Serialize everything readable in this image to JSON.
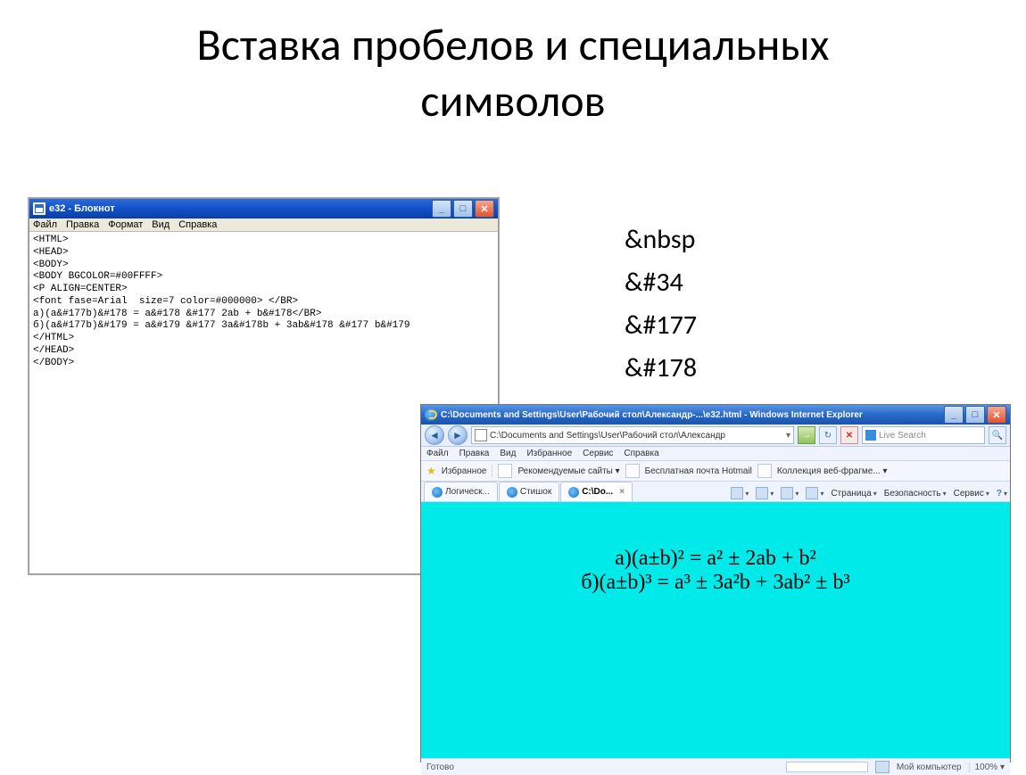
{
  "slide": {
    "title_line1": "Вставка пробелов и специальных",
    "title_line2": "символов"
  },
  "entities": {
    "e1": "&nbsp",
    "e2": "&#34",
    "e3": "&#177",
    "e4": "&#178"
  },
  "notepad": {
    "title": "е32 - Блокнот",
    "menus": {
      "file": "Файл",
      "edit": "Правка",
      "format": "Формат",
      "view": "Вид",
      "help": "Справка"
    },
    "body": "<HTML>\n<HEAD>\n<BODY>\n<BODY BGCOLOR=#00FFFF>\n<P ALIGN=CENTER>\n<font fase=Arial  size=7 color=#000000> </BR>\nа)(a&#177b)&#178 = a&#178 &#177 2ab + b&#178</BR>\nб)(a&#177b)&#179 = a&#179 &#177 3a&#178b + 3ab&#178 &#177 b&#179\n</HTML>\n</HEAD>\n</BODY>"
  },
  "ie": {
    "title": "C:\\Documents and Settings\\User\\Рабочий стол\\Александр-...\\е32.html - Windows Internet Explorer",
    "address": "C:\\Documents and Settings\\User\\Рабочий стол\\Александр",
    "search_placeholder": "Live Search",
    "menus": {
      "file": "Файл",
      "edit": "Правка",
      "view": "Вид",
      "favorites": "Избранное",
      "service": "Сервис",
      "help": "Справка"
    },
    "favbar": {
      "label": "Избранное",
      "rec": "Рекомендуемые сайты ▾",
      "hotmail": "Бесплатная почта Hotmail",
      "frag": "Коллекция веб-фрагме... ▾"
    },
    "tabs": {
      "t1": "Логическ...",
      "t2": "Стишок",
      "t3": "C:\\Do..."
    },
    "tools": {
      "page": "Страница",
      "safety": "Безопасность",
      "service": "Сервис"
    },
    "content": {
      "line1": "а)(a±b)² = a² ± 2ab + b²",
      "line2": "б)(a±b)³ = a³ ± 3a²b + 3ab² ± b³"
    },
    "status": {
      "ready": "Готово",
      "zone": "Мой компьютер",
      "zoom": "100%  ▾"
    }
  }
}
